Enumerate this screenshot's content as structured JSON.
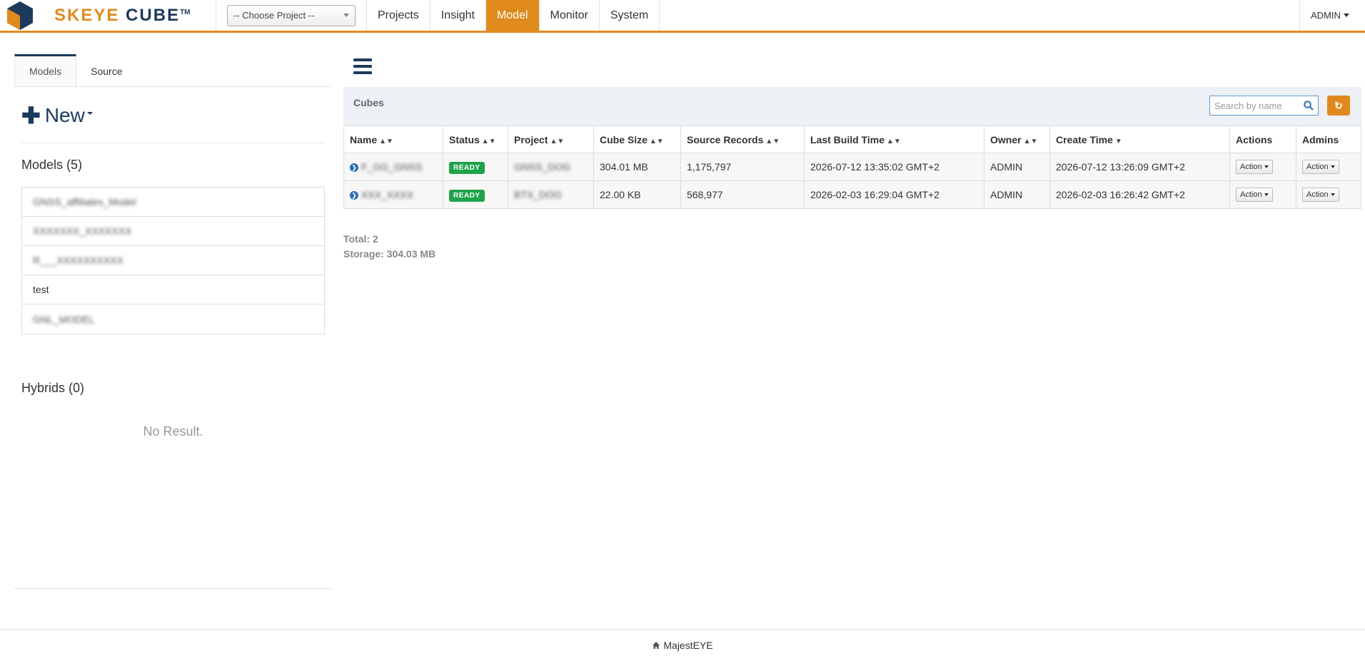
{
  "navbar": {
    "brand_main": "SKEYE",
    "brand_cube": "CUBE",
    "brand_tm": "TM",
    "project_select": "-- Choose Project --",
    "items": [
      {
        "label": "Projects",
        "active": false
      },
      {
        "label": "Insight",
        "active": false
      },
      {
        "label": "Model",
        "active": true
      },
      {
        "label": "Monitor",
        "active": false
      },
      {
        "label": "System",
        "active": false
      }
    ],
    "user": "ADMIN",
    "accent_color": "#e08a1e"
  },
  "left": {
    "tabs": [
      "Models",
      "Source"
    ],
    "new_label": "New",
    "models_title": "Models (5)",
    "models": [
      {
        "label": "GNSS_affiliates_Model",
        "blurred": true
      },
      {
        "label": "XXXXXXX_XXXXXXX",
        "blurred": true
      },
      {
        "label": "R___XXXXXXXXXX",
        "blurred": true
      },
      {
        "label": "test",
        "blurred": false
      },
      {
        "label": "GNL_MODEL",
        "blurred": true
      }
    ],
    "hybrids_title": "Hybrids (0)",
    "no_result": "No Result."
  },
  "cubes": {
    "title": "Cubes",
    "search_placeholder": "Search by name",
    "columns": [
      "Name",
      "Status",
      "Project",
      "Cube Size",
      "Source Records",
      "Last Build Time",
      "Owner",
      "Create Time",
      "Actions",
      "Admins"
    ],
    "rows": [
      {
        "name": "F_GG_GNSS",
        "status": "READY",
        "project": "GNSS_DOG",
        "size": "304.01 MB",
        "records": "1,175,797",
        "last_build": "2026-07-12 13:35:02 GMT+2",
        "owner": "ADMIN",
        "create": "2026-07-12 13:26:09 GMT+2",
        "action": "Action",
        "admin": "Action"
      },
      {
        "name": "XXX_XXXX",
        "status": "READY",
        "project": "BTX_DOG",
        "size": "22.00 KB",
        "records": "568,977",
        "last_build": "2026-02-03 16:29:04 GMT+2",
        "owner": "ADMIN",
        "create": "2026-02-03 16:26:42 GMT+2",
        "action": "Action",
        "admin": "Action"
      }
    ],
    "total": "Total: 2",
    "storage": "Storage: 304.03 MB"
  },
  "footer": {
    "label": "MajestEYE"
  }
}
